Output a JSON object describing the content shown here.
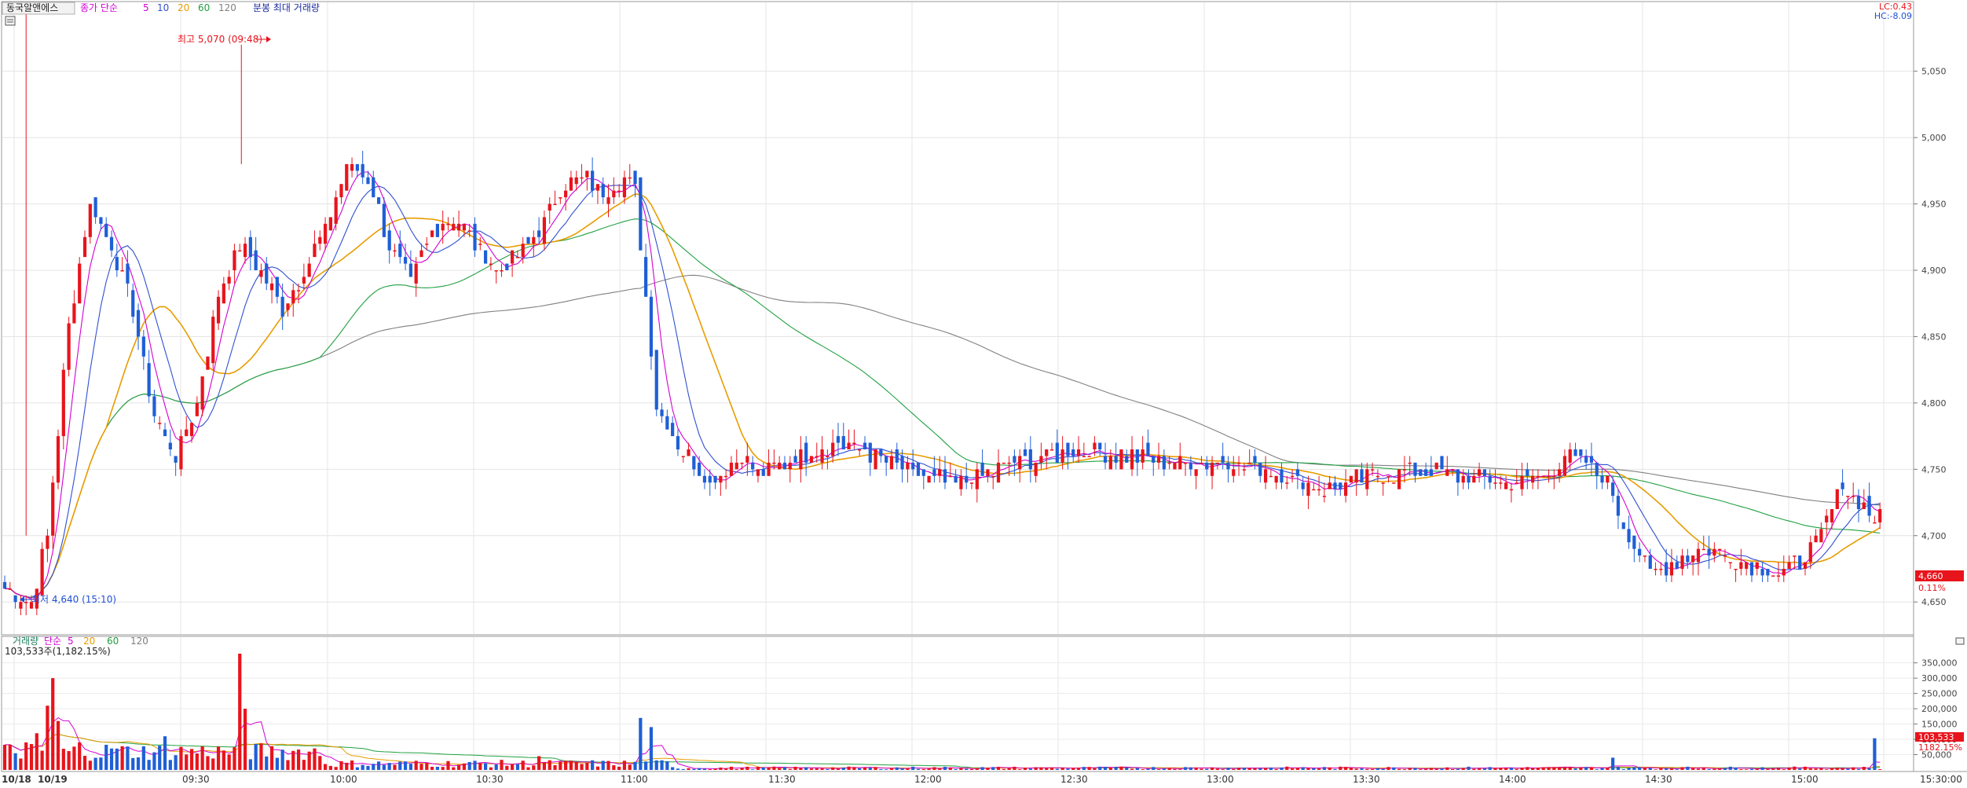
{
  "header": {
    "stock_name": "동국알앤에스",
    "price_legend": [
      "종가 단순",
      "5",
      "10",
      "20",
      "60",
      "120"
    ],
    "price_legend_colors": [
      "#d400d4",
      "#d400d4",
      "#3050d0",
      "#e89c00",
      "#20a040",
      "#808080"
    ],
    "minute_label": "분봉 최대 거래량",
    "lc": "LC:0.43",
    "hc": "HC:-8.09"
  },
  "price_axis": {
    "ticks": [
      "5,050",
      "5,000",
      "4,950",
      "4,900",
      "4,850",
      "4,800",
      "4,750",
      "4,700",
      "4,650"
    ],
    "current_price": "4,660",
    "current_pct": "0.11%"
  },
  "annotations": {
    "high": "최고 5,070 (09:48)",
    "low": "최저 4,640 (15:10)"
  },
  "volume_panel": {
    "legend": [
      "거래량",
      "단순",
      "5",
      "20",
      "60",
      "120"
    ],
    "legend_colors": [
      "#208060",
      "#d400d4",
      "#d400d4",
      "#e89c00",
      "#20a040",
      "#808080"
    ],
    "max_volume_label": "103,533주(1,182.15%)",
    "ticks": [
      "350,000",
      "300,000",
      "250,000",
      "200,000",
      "150,000",
      "100,000",
      "50,000"
    ],
    "current_volume": "103,533",
    "current_volume_pct": "1182.15%"
  },
  "time_axis": {
    "labels": [
      "10/18",
      "10/19",
      "09:30",
      "10:00",
      "10:30",
      "11:00",
      "11:30",
      "12:00",
      "12:30",
      "13:00",
      "13:30",
      "14:00",
      "14:30",
      "15:00",
      "15:30:00"
    ]
  },
  "chart_data": {
    "type": "candlestick",
    "y_range": [
      4630,
      5080
    ],
    "volume_range": [
      0,
      380000
    ],
    "anchors": [
      [
        0,
        4660
      ],
      [
        5,
        4650
      ],
      [
        8,
        4700
      ],
      [
        12,
        4860
      ],
      [
        16,
        4950
      ],
      [
        20,
        4920
      ],
      [
        24,
        4870
      ],
      [
        28,
        4790
      ],
      [
        32,
        4760
      ],
      [
        36,
        4800
      ],
      [
        40,
        4880
      ],
      [
        44,
        4920
      ],
      [
        48,
        4900
      ],
      [
        52,
        4870
      ],
      [
        56,
        4900
      ],
      [
        60,
        4930
      ],
      [
        64,
        4980
      ],
      [
        68,
        4970
      ],
      [
        72,
        4920
      ],
      [
        76,
        4890
      ],
      [
        80,
        4930
      ],
      [
        84,
        4940
      ],
      [
        88,
        4920
      ],
      [
        92,
        4900
      ],
      [
        96,
        4910
      ],
      [
        100,
        4930
      ],
      [
        104,
        4960
      ],
      [
        108,
        4970
      ],
      [
        112,
        4960
      ],
      [
        116,
        4970
      ],
      [
        118,
        4960
      ],
      [
        120,
        4880
      ],
      [
        122,
        4800
      ],
      [
        126,
        4770
      ],
      [
        132,
        4740
      ],
      [
        138,
        4760
      ],
      [
        142,
        4745
      ],
      [
        148,
        4760
      ],
      [
        156,
        4770
      ],
      [
        164,
        4760
      ],
      [
        170,
        4745
      ],
      [
        178,
        4740
      ],
      [
        186,
        4750
      ],
      [
        194,
        4760
      ],
      [
        202,
        4765
      ],
      [
        210,
        4760
      ],
      [
        220,
        4755
      ],
      [
        230,
        4755
      ],
      [
        240,
        4745
      ],
      [
        248,
        4735
      ],
      [
        256,
        4745
      ],
      [
        264,
        4750
      ],
      [
        272,
        4745
      ],
      [
        280,
        4740
      ],
      [
        288,
        4745
      ],
      [
        292,
        4760
      ],
      [
        296,
        4755
      ],
      [
        300,
        4740
      ],
      [
        304,
        4700
      ],
      [
        308,
        4670
      ],
      [
        312,
        4680
      ],
      [
        318,
        4690
      ],
      [
        326,
        4680
      ],
      [
        332,
        4670
      ],
      [
        336,
        4680
      ],
      [
        340,
        4700
      ],
      [
        344,
        4740
      ],
      [
        347,
        4725
      ],
      [
        350,
        4715
      ]
    ],
    "volume_spikes": [
      [
        4,
        90000
      ],
      [
        6,
        120000
      ],
      [
        8,
        210000
      ],
      [
        9,
        300000
      ],
      [
        10,
        160000
      ],
      [
        44,
        380000
      ],
      [
        45,
        200000
      ],
      [
        30,
        110000
      ],
      [
        20,
        70000
      ],
      [
        14,
        90000
      ],
      [
        119,
        170000
      ],
      [
        121,
        140000
      ],
      [
        100,
        45000
      ],
      [
        301,
        40000
      ],
      [
        350,
        103533
      ]
    ],
    "ma_colors": {
      "ma5": "#d400d4",
      "ma10": "#3050d0",
      "ma20": "#e89c00",
      "ma60": "#20a040",
      "ma120": "#808080"
    },
    "candle_colors": {
      "up": "#e8141c",
      "down": "#1f5fd6"
    }
  }
}
